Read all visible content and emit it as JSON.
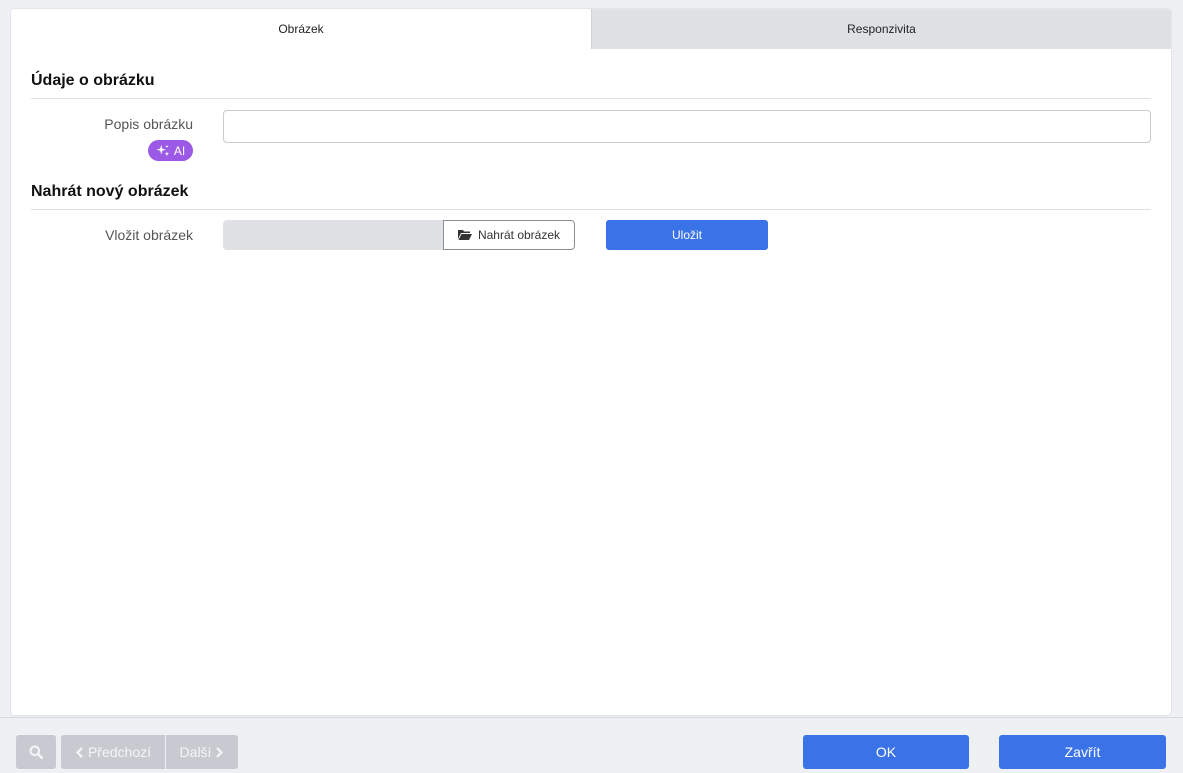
{
  "tabs": [
    {
      "label": "Obrázek"
    },
    {
      "label": "Responzivita"
    }
  ],
  "section_details": {
    "title": "Údaje o obrázku",
    "description_label": "Popis obrázku",
    "ai_badge_label": "AI",
    "description_value": ""
  },
  "section_upload": {
    "title": "Nahrát nový obrázek",
    "insert_label": "Vložit obrázek",
    "upload_button_label": "Nahrát obrázek",
    "save_button_label": "Uložit"
  },
  "footer": {
    "prev_label": "Předchozí",
    "next_label": "Další",
    "ok_label": "OK",
    "close_label": "Zavřít"
  },
  "colors": {
    "primary": "#3a73e8",
    "ai_badge": "#9b59e6",
    "disabled_button": "#c7cbd1"
  }
}
